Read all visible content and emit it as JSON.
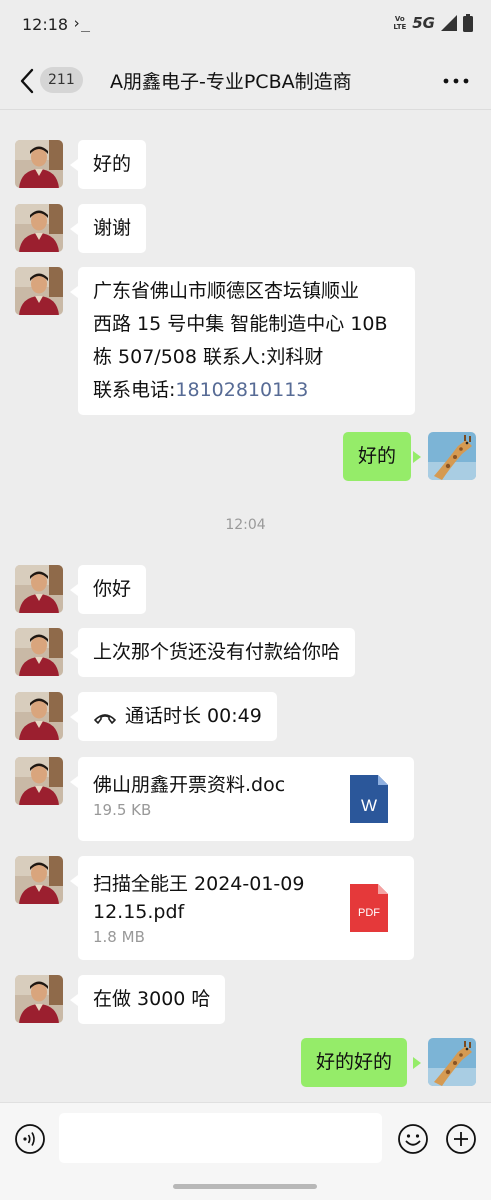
{
  "status": {
    "time": "12:18",
    "terminal": "›_",
    "volte": "Vo LTE",
    "network": "5G"
  },
  "header": {
    "unread": "211",
    "title": "A朋鑫电子-专业PCBA制造商"
  },
  "messages": {
    "m1": "好的",
    "m2": "谢谢",
    "m3": {
      "line1": "广东省佛山市顺德区杏坛镇顺业",
      "line2": "西路 15 号中集 智能制造中心 10B",
      "line3": "栋 507/508 联系人:刘科财",
      "line4_prefix": "联系电话:",
      "phone": "18102810113"
    },
    "m4": "好的",
    "timestamp": "12:04",
    "m5": "你好",
    "m6": "上次那个货还没有付款给你哈",
    "m7": {
      "label": "通话时长 00:49",
      "icon": "phone-hangup-icon"
    },
    "m8": {
      "filename": "佛山朋鑫开票资料.doc",
      "size": "19.5 KB",
      "icon_letter": "W",
      "icon_color": "#2b579a"
    },
    "m9": {
      "filename_line1": "扫描全能王 2024-01-09",
      "filename_line2": "12.15.pdf",
      "size": "1.8 MB",
      "icon_letter": "PDF",
      "icon_color": "#e5393a"
    },
    "m10": "在做 3000 哈",
    "m11": "好的好的"
  },
  "colors": {
    "background": "#ededed",
    "outgoing_bubble": "#95ec69",
    "incoming_bubble": "#ffffff",
    "link": "#576b95"
  }
}
